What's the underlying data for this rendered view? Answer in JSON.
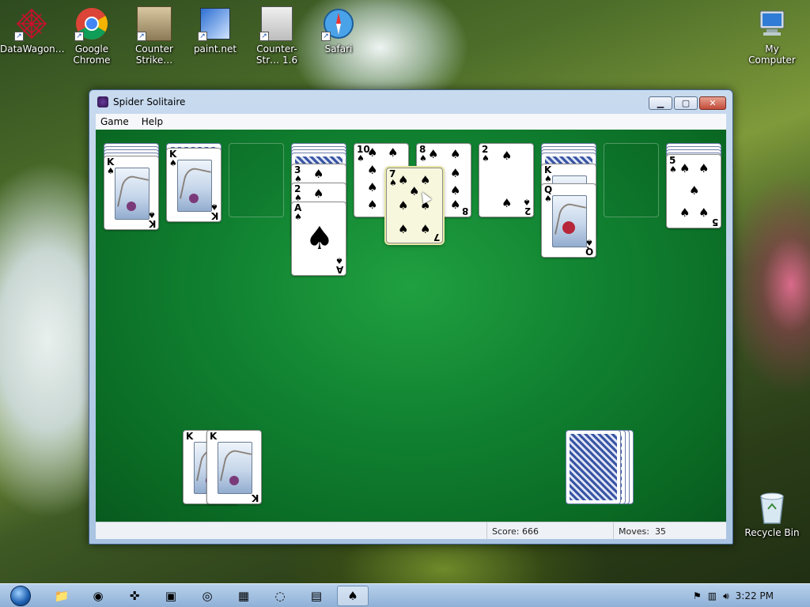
{
  "desktop": {
    "icons": [
      {
        "label": "DataWagon…",
        "name": "datawagon-icon"
      },
      {
        "label": "Google Chrome",
        "name": "chrome-icon"
      },
      {
        "label": "Counter Strike…",
        "name": "counter-strike-icon"
      },
      {
        "label": "paint.net",
        "name": "paintnet-icon"
      },
      {
        "label": "Counter-Str… 1.6",
        "name": "counter-strike-16-icon"
      },
      {
        "label": "Safari",
        "name": "safari-icon"
      },
      {
        "label": "My Computer",
        "name": "computer-icon"
      },
      {
        "label": "Recycle Bin",
        "name": "recycle-bin-icon"
      }
    ]
  },
  "window": {
    "title": "Spider Solitaire",
    "menu": [
      "Game",
      "Help"
    ],
    "controls": {
      "minimize": "▁",
      "maximize": "▢",
      "close": "✕"
    }
  },
  "game": {
    "columns": [
      {
        "hidden": 4,
        "face_up": [
          {
            "rank": "K",
            "suit": "♠"
          }
        ]
      },
      {
        "hidden": 1,
        "face_up": [
          {
            "rank": "K",
            "suit": "♠"
          }
        ]
      },
      {
        "hidden": 0,
        "face_up": []
      },
      {
        "hidden": 4,
        "face_up": [
          {
            "rank": "3",
            "suit": "♠"
          },
          {
            "rank": "2",
            "suit": "♠"
          },
          {
            "rank": "A",
            "suit": "♠"
          }
        ]
      },
      {
        "hidden": 0,
        "face_up": [
          {
            "rank": "10",
            "suit": "♠"
          }
        ]
      },
      {
        "hidden": 0,
        "face_up": [
          {
            "rank": "8",
            "suit": "♠"
          }
        ]
      },
      {
        "hidden": 0,
        "face_up": [
          {
            "rank": "2",
            "suit": "♠"
          }
        ]
      },
      {
        "hidden": 4,
        "face_up": [
          {
            "rank": "K",
            "suit": "♠"
          },
          {
            "rank": "Q",
            "suit": "♠"
          }
        ]
      },
      {
        "hidden": 0,
        "face_up": []
      },
      {
        "hidden": 4,
        "face_up": [
          {
            "rank": "5",
            "suit": "♠"
          }
        ]
      }
    ],
    "dragging_card": {
      "rank": "7",
      "suit": "♠"
    },
    "completed_sets": [
      "K",
      "K"
    ],
    "stock_piles": 4
  },
  "status": {
    "score_label": "Score:",
    "score_value": "666",
    "moves_label": "Moves:",
    "moves_value": "35"
  },
  "taskbar": {
    "clock": "3:22 PM"
  }
}
